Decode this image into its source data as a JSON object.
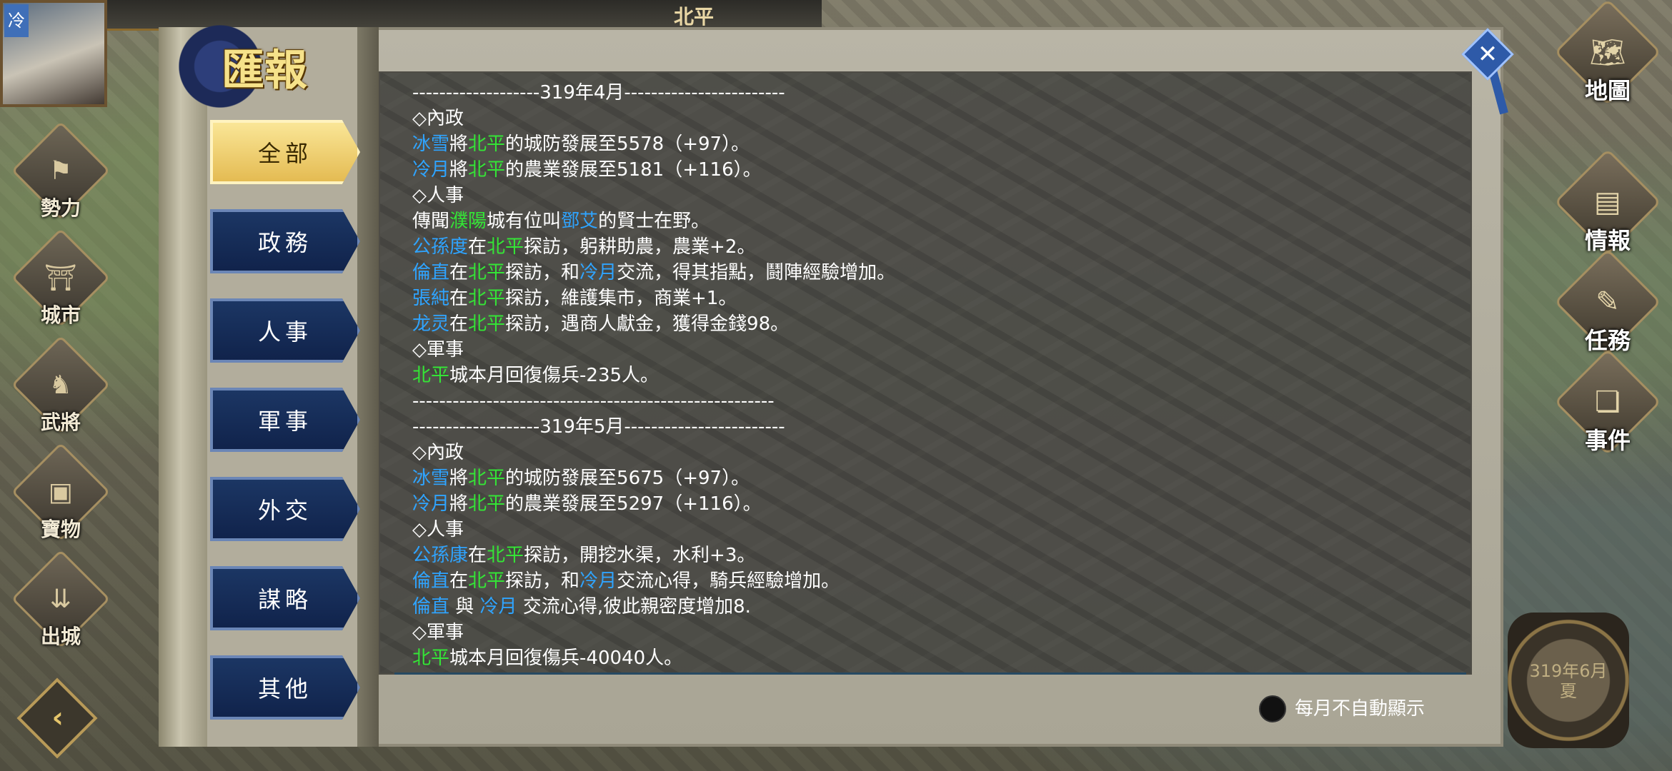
{
  "topbar": {
    "avatar_tag": "冷",
    "city": "北平",
    "num1": "",
    "num2": ""
  },
  "left_nav": [
    {
      "label": "勢力",
      "icon": "banner-icon"
    },
    {
      "label": "城市",
      "icon": "city-gate-icon"
    },
    {
      "label": "武將",
      "icon": "general-icon"
    },
    {
      "label": "寶物",
      "icon": "treasure-chest-icon"
    },
    {
      "label": "出城",
      "icon": "march-out-icon"
    }
  ],
  "back_button": "‹",
  "right_nav": [
    {
      "label": "地圖",
      "icon": "map-icon"
    },
    {
      "label": "情報",
      "icon": "intel-book-icon"
    },
    {
      "label": "任務",
      "icon": "task-scroll-icon"
    },
    {
      "label": "事件",
      "icon": "event-scroll-icon"
    }
  ],
  "date_badge": {
    "line1": "319年6月",
    "line2": "夏"
  },
  "panel": {
    "title": "匯報",
    "close": "✕",
    "tabs": [
      "全部",
      "政務",
      "人事",
      "軍事",
      "外交",
      "謀略",
      "其他"
    ],
    "active_tab": "全部",
    "toggle_label": "每月不自動顯示"
  },
  "colors": {
    "person": "#2fa4ff",
    "city": "#34e536",
    "active_tab": "#f0c95c",
    "inactive_tab": "#1c3765"
  },
  "report_lines": [
    {
      "type": "sep",
      "segments": [
        {
          "t": "-------------------319年4月------------------------",
          "k": ""
        }
      ]
    },
    {
      "type": "head",
      "segments": [
        {
          "t": "◇內政",
          "k": ""
        }
      ]
    },
    {
      "segments": [
        {
          "t": "冰雪",
          "k": "p"
        },
        {
          "t": "將",
          "k": ""
        },
        {
          "t": "北平",
          "k": "c"
        },
        {
          "t": "的城防發展至5578（+97）。",
          "k": ""
        }
      ]
    },
    {
      "segments": [
        {
          "t": "冷月",
          "k": "p"
        },
        {
          "t": "將",
          "k": ""
        },
        {
          "t": "北平",
          "k": "c"
        },
        {
          "t": "的農業發展至5181（+116）。",
          "k": ""
        }
      ]
    },
    {
      "type": "head",
      "segments": [
        {
          "t": "◇人事",
          "k": ""
        }
      ]
    },
    {
      "segments": [
        {
          "t": " 傳聞",
          "k": ""
        },
        {
          "t": "濮陽",
          "k": "c"
        },
        {
          "t": "城有位叫",
          "k": ""
        },
        {
          "t": "鄧艾",
          "k": "p"
        },
        {
          "t": "的賢士在野。",
          "k": ""
        }
      ]
    },
    {
      "segments": [
        {
          "t": "公孫度",
          "k": "p"
        },
        {
          "t": "在",
          "k": ""
        },
        {
          "t": "北平",
          "k": "c"
        },
        {
          "t": "探訪，躬耕助農，農業+2。",
          "k": ""
        }
      ]
    },
    {
      "segments": [
        {
          "t": "倫直",
          "k": "p"
        },
        {
          "t": "在",
          "k": ""
        },
        {
          "t": "北平",
          "k": "c"
        },
        {
          "t": "探訪，和",
          "k": ""
        },
        {
          "t": "冷月",
          "k": "p"
        },
        {
          "t": "交流，得其指點，鬪陣經驗增加。",
          "k": ""
        }
      ]
    },
    {
      "segments": [
        {
          "t": "張純",
          "k": "p"
        },
        {
          "t": "在",
          "k": ""
        },
        {
          "t": "北平",
          "k": "c"
        },
        {
          "t": "探訪，維護集市，商業+1。",
          "k": ""
        }
      ]
    },
    {
      "segments": [
        {
          "t": "龙灵",
          "k": "p"
        },
        {
          "t": "在",
          "k": ""
        },
        {
          "t": "北平",
          "k": "c"
        },
        {
          "t": "探訪，遇商人獻金，獲得金錢98。",
          "k": ""
        }
      ]
    },
    {
      "type": "head",
      "segments": [
        {
          "t": "◇軍事",
          "k": ""
        }
      ]
    },
    {
      "segments": [
        {
          "t": "北平",
          "k": "c"
        },
        {
          "t": "城本月回復傷兵-235人。",
          "k": ""
        }
      ]
    },
    {
      "type": "sep",
      "segments": [
        {
          "t": "------------------------------------------------------",
          "k": ""
        }
      ]
    },
    {
      "type": "sep",
      "segments": [
        {
          "t": "-------------------319年5月------------------------",
          "k": ""
        }
      ]
    },
    {
      "type": "head",
      "segments": [
        {
          "t": "◇內政",
          "k": ""
        }
      ]
    },
    {
      "segments": [
        {
          "t": "冰雪",
          "k": "p"
        },
        {
          "t": "將",
          "k": ""
        },
        {
          "t": "北平",
          "k": "c"
        },
        {
          "t": "的城防發展至5675（+97）。",
          "k": ""
        }
      ]
    },
    {
      "segments": [
        {
          "t": "冷月",
          "k": "p"
        },
        {
          "t": "將",
          "k": ""
        },
        {
          "t": "北平",
          "k": "c"
        },
        {
          "t": "的農業發展至5297（+116）。",
          "k": ""
        }
      ]
    },
    {
      "type": "head",
      "segments": [
        {
          "t": "◇人事",
          "k": ""
        }
      ]
    },
    {
      "segments": [
        {
          "t": "公孫康",
          "k": "p"
        },
        {
          "t": "在",
          "k": ""
        },
        {
          "t": "北平",
          "k": "c"
        },
        {
          "t": "探訪，開挖水渠，水利+3。",
          "k": ""
        }
      ]
    },
    {
      "segments": [
        {
          "t": "倫直",
          "k": "p"
        },
        {
          "t": "在",
          "k": ""
        },
        {
          "t": "北平",
          "k": "c"
        },
        {
          "t": "探訪，和",
          "k": ""
        },
        {
          "t": "冷月",
          "k": "p"
        },
        {
          "t": "交流心得，騎兵經驗增加。",
          "k": ""
        }
      ]
    },
    {
      "segments": [
        {
          "t": "倫直",
          "k": "p"
        },
        {
          "t": " 與 ",
          "k": ""
        },
        {
          "t": "冷月",
          "k": "p"
        },
        {
          "t": " 交流心得,彼此親密度增加8.",
          "k": ""
        }
      ]
    },
    {
      "type": "head",
      "segments": [
        {
          "t": "◇軍事",
          "k": ""
        }
      ]
    },
    {
      "segments": [
        {
          "t": "北平",
          "k": "c"
        },
        {
          "t": "城本月回復傷兵-40040人。",
          "k": ""
        }
      ]
    }
  ]
}
